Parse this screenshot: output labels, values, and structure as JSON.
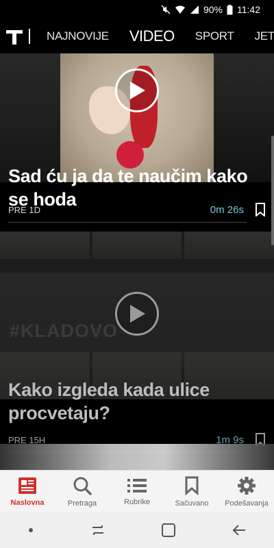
{
  "status_bar": {
    "battery": "90%",
    "time": "11:42"
  },
  "top_nav": {
    "tabs": [
      {
        "label": "NAJNOVIJE",
        "active": false
      },
      {
        "label": "VIDEO",
        "active": true
      },
      {
        "label": "SPORT",
        "active": false
      },
      {
        "label": "JETSET",
        "active": false
      }
    ]
  },
  "feed": {
    "items": [
      {
        "title": "Sad ću ja da te naučim kako se hoda",
        "time_ago": "PRE 1D",
        "duration": "0m 26s"
      },
      {
        "title": "Kako izgleda kada ulice procvetaju?",
        "time_ago": "PRE 15H",
        "duration": "1m 9s",
        "thumb_text": "#KLADOVO"
      }
    ]
  },
  "bottom_nav": {
    "items": [
      {
        "label": "Naslovna",
        "icon": "newspaper-icon",
        "active": true
      },
      {
        "label": "Pretraga",
        "icon": "search-icon",
        "active": false
      },
      {
        "label": "Rubrike",
        "icon": "list-icon",
        "active": false
      },
      {
        "label": "Sačuvano",
        "icon": "bookmark-icon",
        "active": false
      },
      {
        "label": "Podešavanja",
        "icon": "gear-icon",
        "active": false
      }
    ]
  },
  "colors": {
    "accent": "#d32f2f",
    "duration": "#7fc6df"
  }
}
